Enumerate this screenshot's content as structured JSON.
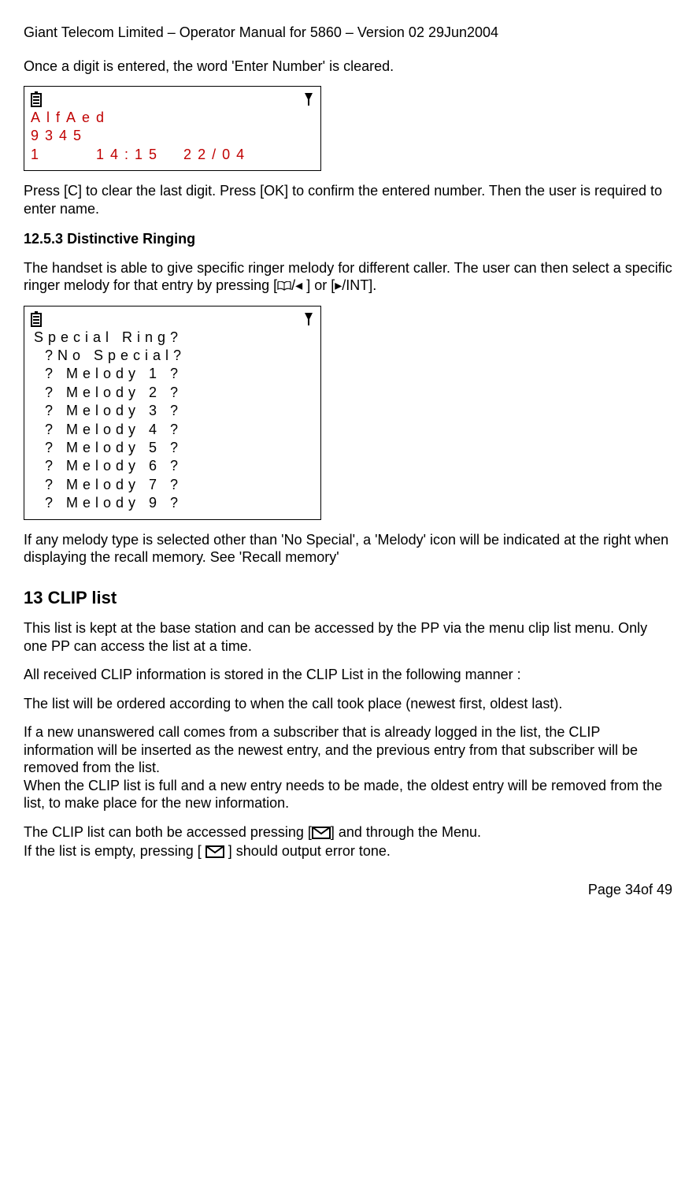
{
  "header": "Giant Telecom Limited – Operator Manual for 5860 – Version 02 29Jun2004",
  "p1": "Once a digit is entered, the word 'Enter Number' is cleared.",
  "screen1": {
    "line1": "AlfAed",
    "line2": "9345",
    "line3": "1     14:15  22/04"
  },
  "p2": "Press [C] to clear the last digit. Press [OK] to confirm the entered number. Then the user is required to enter name.",
  "sub1_num": "12.5.3",
  "sub1_title": "Distinctive Ringing",
  "p3a": "The handset is able to give specific ringer melody for different caller. The user can then select a specific ringer melody for that entry by pressing  [",
  "p3b": "] or [",
  "p3c": "/INT].",
  "book_left_sep": "/",
  "left_tri": "◂",
  "right_tri": "▸",
  "screen2": {
    "title": "Special Ring?",
    "rows": [
      "?No Special?",
      "? Melody 1 ?",
      "? Melody 2 ?",
      "? Melody 3 ?",
      "? Melody 4 ?",
      "? Melody 5 ?",
      "? Melody 6 ?",
      "? Melody 7 ?",
      "? Melody 9 ?"
    ]
  },
  "p4": "If any melody type is selected other than 'No Special', a 'Melody' icon will be indicated at the right when displaying the recall memory.  See 'Recall memory'",
  "sec_num": "13",
  "sec_title": "CLIP list",
  "p5": "This list is kept at the base station and can be accessed by the PP via the menu clip list menu. Only one PP can access the list at a time.",
  "p6": "All received CLIP information is stored in the CLIP List in the following manner :",
  "p7": "The list will be ordered according to when the call took place (newest first, oldest last).",
  "p8": "If a new unanswered call comes from a subscriber that is already logged in the list, the CLIP information will be inserted as the newest entry, and the previous entry from that subscriber will be removed from the list.",
  "p9": "When the CLIP list is full and a new entry needs to be made, the oldest entry will be removed from the list, to make place for the new information.",
  "p10a": "The CLIP list can both be accessed pressing [",
  "p10b": "] and through the Menu.",
  "p11a": "If the list is empty, pressing [",
  "p11b": "] should output error tone.",
  "footer": "Page 34of 49"
}
